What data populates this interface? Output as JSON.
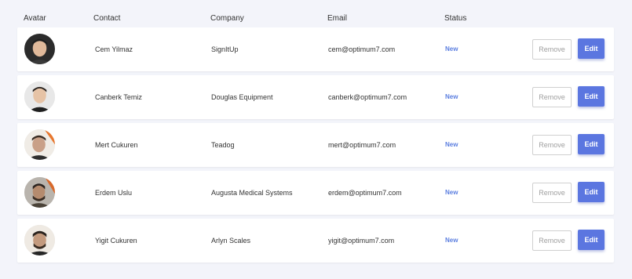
{
  "header": {
    "avatar": "Avatar",
    "contact": "Contact",
    "company": "Company",
    "email": "Email",
    "status": "Status"
  },
  "rows": [
    {
      "contact": "Cem Yilmaz",
      "company": "SignItUp",
      "email": "cem@optimum7.com",
      "status": "New",
      "remove": "Remove",
      "edit": "Edit"
    },
    {
      "contact": "Canberk Temiz",
      "company": "Douglas Equipment",
      "email": "canberk@optimum7.com",
      "status": "New",
      "remove": "Remove",
      "edit": "Edit"
    },
    {
      "contact": "Mert Cukuren",
      "company": "Teadog",
      "email": "mert@optimum7.com",
      "status": "New",
      "remove": "Remove",
      "edit": "Edit"
    },
    {
      "contact": "Erdem Uslu",
      "company": "Augusta Medical Systems",
      "email": "erdem@optimum7.com",
      "status": "New",
      "remove": "Remove",
      "edit": "Edit"
    },
    {
      "contact": "Yigit Cukuren",
      "company": "Arlyn Scales",
      "email": "yigit@optimum7.com",
      "status": "New",
      "remove": "Remove",
      "edit": "Edit"
    }
  ],
  "colors": {
    "background": "#f3f4fa",
    "status": "#5c7fe0",
    "edit_button": "#5b76e0"
  }
}
